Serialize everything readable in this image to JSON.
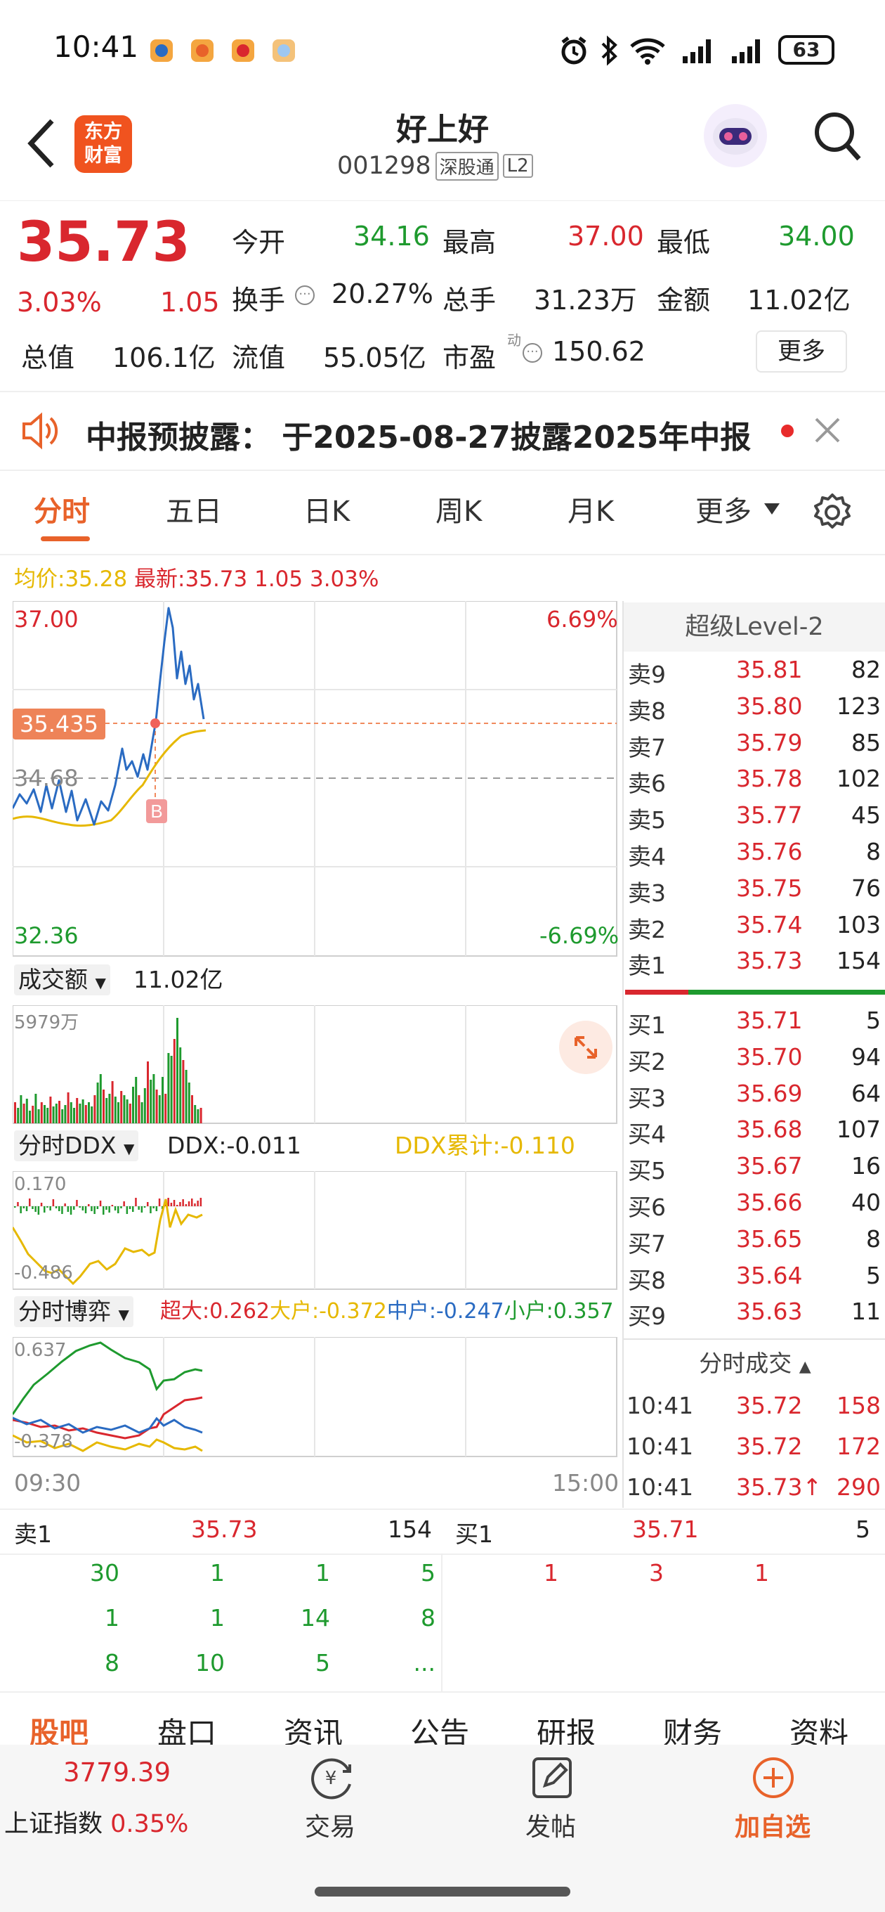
{
  "status_bar": {
    "time": "10:41",
    "battery": "63"
  },
  "header": {
    "logo": "东方\n财富",
    "stock_name": "好上好",
    "stock_code": "001298",
    "badge_sgt": "深股通",
    "badge_l2": "L2"
  },
  "quote": {
    "price": "35.73",
    "change_pct": "3.03%",
    "change": "1.05",
    "open_label": "今开",
    "open": "34.16",
    "high_label": "最高",
    "high": "37.00",
    "low_label": "最低",
    "low": "34.00",
    "turnover_label": "换手",
    "turnover": "20.27%",
    "volume_label": "总手",
    "volume": "31.23万",
    "amount_label": "金额",
    "amount": "11.02亿",
    "mktcap_label": "总值",
    "mktcap": "106.1亿",
    "float_label": "流值",
    "float": "55.05亿",
    "pe_label": "市盈",
    "pe_sup": "动",
    "pe": "150.62",
    "more_button": "更多"
  },
  "notice": {
    "text": "中报预披露： 于2025-08-27披露2025年中报"
  },
  "tabs": [
    "分时",
    "五日",
    "日K",
    "周K",
    "月K",
    "更多"
  ],
  "chart_info": {
    "avg_label": "均价:35.28",
    "latest_label": "最新:35.73 1.05 3.03%"
  },
  "price_chart": {
    "top_price": "37.00",
    "top_pct": "6.69%",
    "bottom_price": "32.36",
    "bottom_pct": "-6.69%",
    "mid_price": "34.68",
    "cursor_price": "35.435",
    "marker": "B"
  },
  "volume_panel": {
    "selector": "成交额",
    "value": "11.02亿",
    "max_label": "5979万"
  },
  "ddx_panel": {
    "selector": "分时DDX",
    "ddx": "DDX:-0.011",
    "ddx_cum": "DDX累计:-0.110",
    "top": "0.170",
    "bottom": "-0.486"
  },
  "game_panel": {
    "selector": "分时博弈",
    "super": "超大:0.262",
    "large": "大户:-0.372",
    "mid": "中户:-0.247",
    "small": "小户:0.357",
    "top": "0.637",
    "bottom": "-0.378"
  },
  "time_axis": {
    "start": "09:30",
    "end": "15:00"
  },
  "level2": {
    "title": "超级Level-2",
    "asks": [
      {
        "label": "卖9",
        "price": "35.81",
        "vol": "82"
      },
      {
        "label": "卖8",
        "price": "35.80",
        "vol": "123"
      },
      {
        "label": "卖7",
        "price": "35.79",
        "vol": "85"
      },
      {
        "label": "卖6",
        "price": "35.78",
        "vol": "102"
      },
      {
        "label": "卖5",
        "price": "35.77",
        "vol": "45"
      },
      {
        "label": "卖4",
        "price": "35.76",
        "vol": "8"
      },
      {
        "label": "卖3",
        "price": "35.75",
        "vol": "76"
      },
      {
        "label": "卖2",
        "price": "35.74",
        "vol": "103"
      },
      {
        "label": "卖1",
        "price": "35.73",
        "vol": "154"
      }
    ],
    "bids": [
      {
        "label": "买1",
        "price": "35.71",
        "vol": "5"
      },
      {
        "label": "买2",
        "price": "35.70",
        "vol": "94"
      },
      {
        "label": "买3",
        "price": "35.69",
        "vol": "64"
      },
      {
        "label": "买4",
        "price": "35.68",
        "vol": "107"
      },
      {
        "label": "买5",
        "price": "35.67",
        "vol": "16"
      },
      {
        "label": "买6",
        "price": "35.66",
        "vol": "40"
      },
      {
        "label": "买7",
        "price": "35.65",
        "vol": "8"
      },
      {
        "label": "买8",
        "price": "35.64",
        "vol": "5"
      },
      {
        "label": "买9",
        "price": "35.63",
        "vol": "11"
      }
    ],
    "ticks_title": "分时成交",
    "ticks": [
      {
        "time": "10:41",
        "price": "35.72",
        "vol": "158"
      },
      {
        "time": "10:41",
        "price": "35.72",
        "vol": "172"
      },
      {
        "time": "10:41",
        "price": "35.73↑",
        "vol": "290"
      }
    ]
  },
  "queue": {
    "sell_label": "卖1",
    "sell_price": "35.73",
    "sell_vol": "154",
    "buy_label": "买1",
    "buy_price": "35.71",
    "buy_vol": "5",
    "sell_orders": [
      [
        "30",
        "1",
        "1",
        "5"
      ],
      [
        "1",
        "1",
        "14",
        "8"
      ],
      [
        "8",
        "10",
        "5",
        "..."
      ]
    ],
    "buy_orders": [
      [
        "1",
        "3",
        "1"
      ]
    ]
  },
  "bottom_tabs": [
    "股吧",
    "盘口",
    "资讯",
    "公告",
    "研报",
    "财务",
    "资料"
  ],
  "index": {
    "value": "3779.39",
    "name": "上证指数",
    "pct": "0.35%"
  },
  "actions": {
    "trade": "交易",
    "post": "发帖",
    "add": "加自选"
  },
  "colors": {
    "up": "#d9272e",
    "down": "#1e9a2e",
    "accent": "#e8622a",
    "line": "#2a6bc2",
    "avg": "#e6b800"
  }
}
